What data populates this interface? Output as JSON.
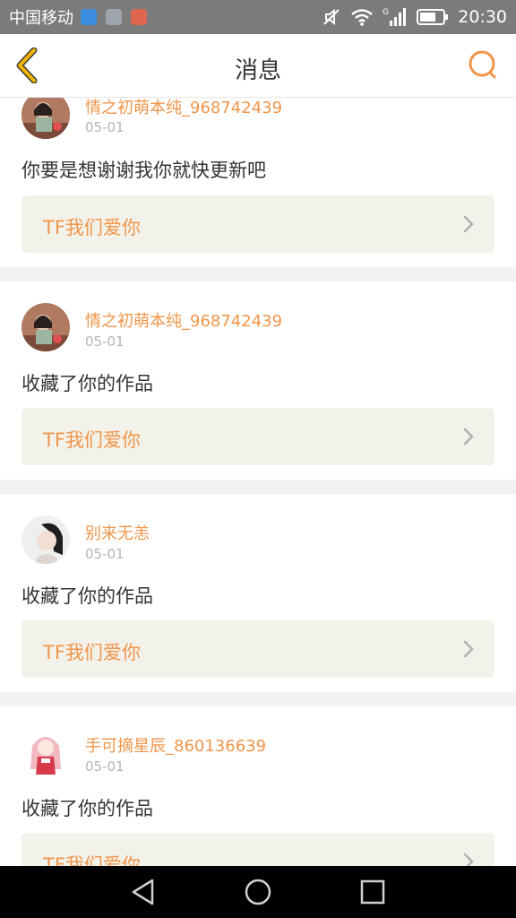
{
  "status_bar": {
    "carrier": "中国移动",
    "time": "20:30",
    "icons": [
      "app-blue-icon",
      "gallery-icon",
      "app-red-icon",
      "mute-icon",
      "wifi-icon",
      "signal-icon",
      "battery-icon"
    ]
  },
  "header": {
    "title": "消息",
    "back_icon": "back-chevron-icon",
    "search_icon": "search-icon"
  },
  "messages": [
    {
      "username": "情之初萌本纯_968742439",
      "date": "05-01",
      "text": "你要是想谢谢我你就快更新吧",
      "work": "TF我们爱你"
    },
    {
      "username": "情之初萌本纯_968742439",
      "date": "05-01",
      "text": "收藏了你的作品",
      "work": "TF我们爱你"
    },
    {
      "username": "别来无恙",
      "date": "05-01",
      "text": "收藏了你的作品",
      "work": "TF我们爱你"
    },
    {
      "username": "手可摘星辰_860136639",
      "date": "05-01",
      "text": "收藏了你的作品",
      "work": "TF我们爱你"
    }
  ],
  "colors": {
    "accent": "#f0954a",
    "header_back": "#f0b400",
    "status_bar": "#7b7b7b",
    "card_work_bg": "#f3f2ea",
    "separator": "#f2f2f2"
  },
  "nav_bar": {
    "buttons": [
      "back-triangle-icon",
      "home-circle-icon",
      "recents-square-icon"
    ]
  }
}
